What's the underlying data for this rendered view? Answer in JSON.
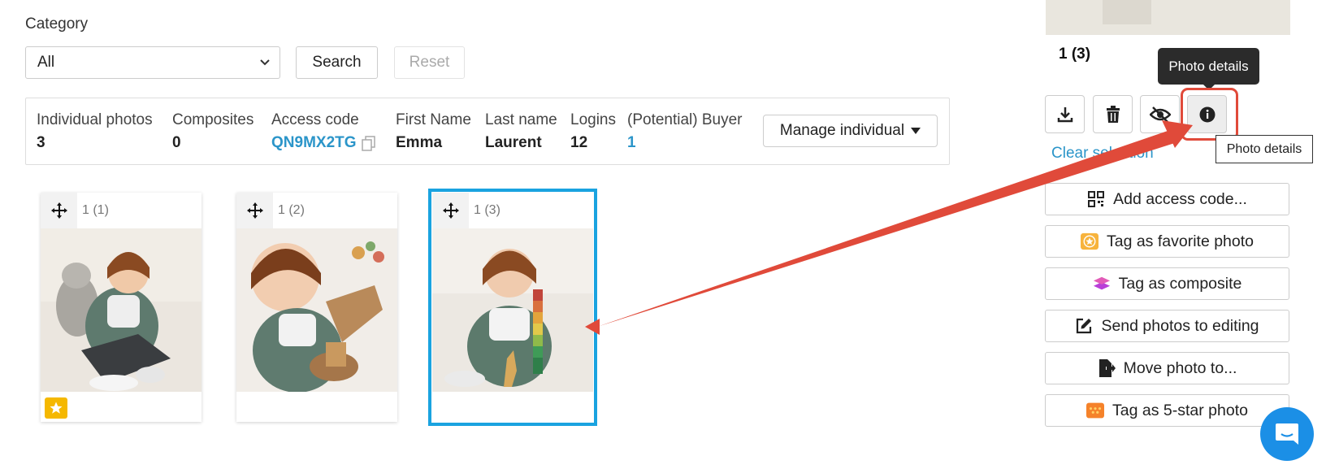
{
  "filters": {
    "category_label": "Category",
    "category_value": "All",
    "search_label": "Search",
    "reset_label": "Reset"
  },
  "info_bar": {
    "individual_photos": {
      "label": "Individual photos",
      "value": "3"
    },
    "composites": {
      "label": "Composites",
      "value": "0"
    },
    "access_code": {
      "label": "Access code",
      "value": "QN9MX2TG"
    },
    "first_name": {
      "label": "First Name",
      "value": "Emma"
    },
    "last_name": {
      "label": "Last name",
      "value": "Laurent"
    },
    "logins": {
      "label": "Logins",
      "value": "12"
    },
    "buyer": {
      "label": "(Potential) Buyer",
      "value": "1"
    },
    "manage_label": "Manage individual"
  },
  "photos": [
    {
      "position": "1 (1)",
      "favorite": true
    },
    {
      "position": "1 (2)",
      "favorite": false
    },
    {
      "position": "1 (3)",
      "favorite": false,
      "selected": true
    }
  ],
  "side_panel": {
    "selected_position": "1 (3)",
    "tooltip_dark": "Photo details",
    "tooltip_light": "Photo details",
    "clear_selection": "Clear selection",
    "actions": [
      {
        "label": "Add access code...",
        "icon": "qr-code-icon"
      },
      {
        "label": "Tag as favorite photo",
        "icon": "favorite-star-icon"
      },
      {
        "label": "Tag as composite",
        "icon": "layers-icon"
      },
      {
        "label": "Send photos to editing",
        "icon": "edit-icon"
      },
      {
        "label": "Move photo to...",
        "icon": "move-file-icon"
      },
      {
        "label": "Tag as 5-star photo",
        "icon": "five-star-icon"
      }
    ]
  },
  "colors": {
    "link": "#2b95c9",
    "selection": "#1aa3e0",
    "annotation": "#e04a3a",
    "favorite": "#f5b800"
  }
}
